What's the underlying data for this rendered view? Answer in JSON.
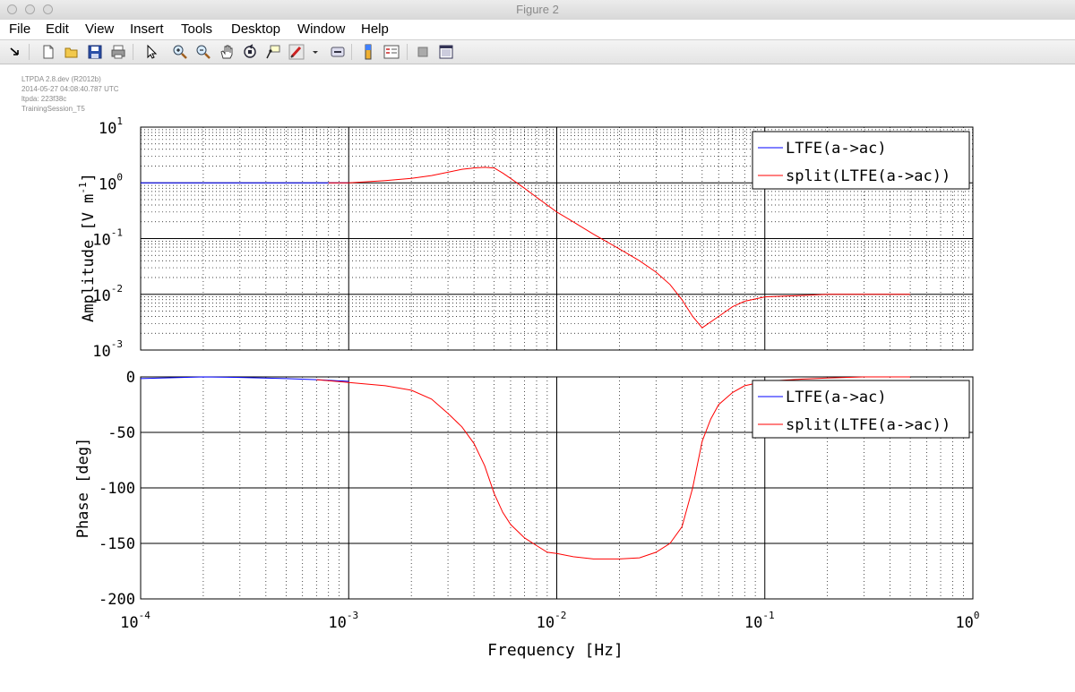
{
  "window": {
    "title": "Figure 2"
  },
  "menu": {
    "items": [
      "File",
      "Edit",
      "View",
      "Insert",
      "Tools",
      "Desktop",
      "Window",
      "Help"
    ]
  },
  "toolbar": {
    "icons": [
      "dock-arrow-icon",
      "new-figure-icon",
      "open-file-icon",
      "save-icon",
      "print-icon",
      "select-arrow-icon",
      "zoom-in-icon",
      "zoom-out-icon",
      "pan-hand-icon",
      "rotate-3d-icon",
      "data-cursor-icon",
      "brush-icon",
      "link-plot-icon",
      "colorbar-icon",
      "legend-icon",
      "hide-plot-tools-icon",
      "show-plot-tools-icon"
    ]
  },
  "info": {
    "line1": "LTPDA 2.8.dev (R2012b)",
    "line2": "2014-05-27 04:08:40.787 UTC",
    "line3": "ltpda: 223f38c",
    "line4": "TrainingSession_T5"
  },
  "chart_data": [
    {
      "type": "line",
      "xscale": "log",
      "yscale": "log",
      "xlim": [
        0.0001,
        1
      ],
      "ylim": [
        0.001,
        10
      ],
      "grid": true,
      "minor_grid": true,
      "ylabel": "Amplitude  [V m^-1]",
      "ylabel_main": "Amplitude  [V m",
      "ylabel_sup": "-1",
      "ylabel_close": "]",
      "legend_position": "top-right",
      "x_ticks": [
        {
          "base": "10",
          "exp": "-4"
        },
        {
          "base": "10",
          "exp": "-3"
        },
        {
          "base": "10",
          "exp": "-2"
        },
        {
          "base": "10",
          "exp": "-1"
        },
        {
          "base": "10",
          "exp": "0"
        }
      ],
      "y_ticks": [
        {
          "base": "10",
          "exp": "1"
        },
        {
          "base": "10",
          "exp": "0"
        },
        {
          "base": "10",
          "exp": "-1"
        },
        {
          "base": "10",
          "exp": "-2"
        },
        {
          "base": "10",
          "exp": "-3"
        }
      ],
      "series": [
        {
          "name": "LTFE(a->ac)",
          "color": "#0000ff",
          "x": [
            0.0001,
            0.0002,
            0.0004,
            0.0006,
            0.0008,
            0.001
          ],
          "y": [
            1.0,
            1.0,
            1.0,
            1.0,
            1.0,
            1.0
          ]
        },
        {
          "name": "split(LTFE(a->ac))",
          "color": "#ff0000",
          "x": [
            0.0008,
            0.001,
            0.0015,
            0.002,
            0.0025,
            0.003,
            0.0035,
            0.004,
            0.0045,
            0.005,
            0.0055,
            0.006,
            0.007,
            0.008,
            0.01,
            0.012,
            0.015,
            0.02,
            0.025,
            0.03,
            0.035,
            0.04,
            0.045,
            0.05,
            0.06,
            0.07,
            0.08,
            0.1,
            0.15,
            0.2,
            0.3,
            0.5
          ],
          "y": [
            1.0,
            1.0,
            1.1,
            1.2,
            1.35,
            1.55,
            1.75,
            1.85,
            1.9,
            1.85,
            1.5,
            1.2,
            0.8,
            0.55,
            0.3,
            0.2,
            0.12,
            0.065,
            0.04,
            0.025,
            0.015,
            0.008,
            0.004,
            0.0025,
            0.004,
            0.006,
            0.0075,
            0.009,
            0.0095,
            0.01,
            0.01,
            0.01
          ]
        }
      ]
    },
    {
      "type": "line",
      "xscale": "log",
      "yscale": "linear",
      "xlim": [
        0.0001,
        1
      ],
      "ylim": [
        -200,
        0
      ],
      "grid": true,
      "minor_grid": true,
      "xlabel": "Frequency  [Hz]",
      "ylabel": "Phase  [deg]",
      "legend_position": "top-right",
      "y_ticks": [
        "0",
        "-50",
        "-100",
        "-150",
        "-200"
      ],
      "series": [
        {
          "name": "LTFE(a->ac)",
          "color": "#0000ff",
          "x": [
            0.0001,
            0.0002,
            0.0003,
            0.0005,
            0.0007,
            0.001
          ],
          "y": [
            -1.5,
            0.0,
            -0.5,
            -1.5,
            -2.5,
            -4.0
          ]
        },
        {
          "name": "split(LTFE(a->ac))",
          "color": "#ff0000",
          "x": [
            0.0007,
            0.001,
            0.0015,
            0.002,
            0.0025,
            0.003,
            0.0035,
            0.004,
            0.0045,
            0.005,
            0.0055,
            0.006,
            0.007,
            0.008,
            0.009,
            0.01,
            0.012,
            0.015,
            0.02,
            0.025,
            0.03,
            0.035,
            0.04,
            0.045,
            0.05,
            0.055,
            0.06,
            0.07,
            0.08,
            0.1,
            0.15,
            0.2,
            0.3,
            0.5
          ],
          "y": [
            -2.5,
            -5,
            -8,
            -12,
            -20,
            -33,
            -45,
            -60,
            -80,
            -105,
            -122,
            -133,
            -145,
            -152,
            -158,
            -159,
            -162,
            -164,
            -164,
            -163,
            -158,
            -150,
            -135,
            -100,
            -58,
            -38,
            -25,
            -14,
            -8,
            -4,
            -2,
            -1,
            0,
            0
          ]
        }
      ]
    }
  ]
}
